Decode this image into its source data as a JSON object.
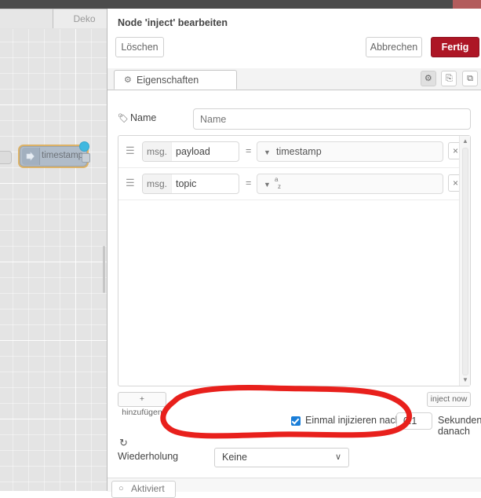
{
  "window": {
    "topbar_accent_color": "#b35c5c",
    "topbar_color": "#4b4b4b"
  },
  "canvas": {
    "tabs": [
      {
        "label": ""
      },
      {
        "label": "Deko"
      }
    ],
    "node": {
      "label": "timestamp",
      "icon": "inject-arrow-icon",
      "badge": "status-dot",
      "selected_outline_color": "#dba951",
      "body_color": "#b0bcc9"
    }
  },
  "dialog": {
    "title": "Node 'inject' bearbeiten",
    "buttons": {
      "delete_label": "Löschen",
      "cancel_label": "Abbrechen",
      "done_label": "Fertig",
      "done_color": "#ad1625"
    },
    "tabs": [
      {
        "label": "Eigenschaften",
        "icon": "gear-icon",
        "active": true
      }
    ],
    "tab_icons": [
      {
        "name": "gear-icon",
        "glyph": "⚙",
        "active": true
      },
      {
        "name": "description-icon",
        "glyph": "⎘",
        "active": false
      },
      {
        "name": "appearance-icon",
        "glyph": "⧉",
        "active": false
      }
    ],
    "name_field": {
      "label": "Name",
      "icon": "tag-icon",
      "value": "",
      "placeholder": "Name"
    },
    "properties": [
      {
        "drag_handle": "drag-handle-icon",
        "prefix": "msg.",
        "property": "payload",
        "operator": "=",
        "type_icon": "chevron-down-icon",
        "value_text": "timestamp",
        "value_kind": "timestamp",
        "delete_label": "×"
      },
      {
        "drag_handle": "drag-handle-icon",
        "prefix": "msg.",
        "property": "topic",
        "operator": "=",
        "type_icon": "chevron-down-icon",
        "value_text": "",
        "value_kind": "string",
        "type_glyph_top": "a",
        "type_glyph_bottom": "z",
        "delete_label": "×"
      }
    ],
    "add_button_label": "+ hinzufügen",
    "inject_now_label": "inject now",
    "once": {
      "checked": true,
      "checkbox_color": "#1a7ed8",
      "label_before": "Einmal injizieren nach",
      "delay_value": "0.1",
      "label_after": "Sekunden, danach"
    },
    "repeat": {
      "icon": "refresh-icon",
      "label": "Wiederholung",
      "selected": "Keine",
      "caret": "∨",
      "options": [
        "Keine"
      ]
    },
    "enabled": {
      "icon": "toggle-off-icon",
      "label": "Aktiviert"
    },
    "scrollbar": {
      "up_arrow": "▲",
      "down_arrow": "▼"
    }
  },
  "annotation": {
    "shape": "hand-drawn-oval",
    "color": "#e8201c",
    "target": "Einmal injizieren nach"
  }
}
